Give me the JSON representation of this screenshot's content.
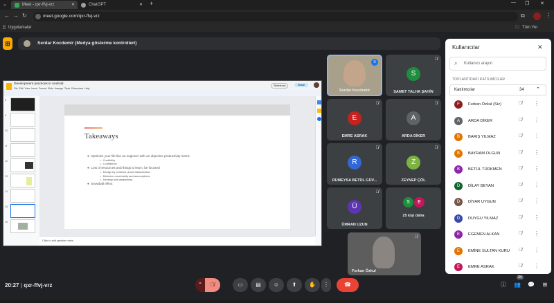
{
  "browser": {
    "tabs": [
      {
        "title": "Meet - qxr-ffvj-vrz",
        "active": true
      },
      {
        "title": "ChatGPT",
        "active": false
      }
    ],
    "new_tab": "+",
    "url": "meet.google.com/qxr-ffvj-vrz",
    "bookmarks_left": "Uygulamalar",
    "bookmarks_right": "Tüm Yer İşaretleri"
  },
  "meet": {
    "presenter_label": "Serdar Kocdemir (Medya gösterme kontrolleri)",
    "meeting_code": "qxr-ffvj-vrz",
    "time": "20:27",
    "slides": {
      "doc_title": "Development practices in Android",
      "menu": [
        "File",
        "Edit",
        "View",
        "Insert",
        "Format",
        "Slide",
        "Arrange",
        "Tools",
        "Extensions",
        "Help"
      ],
      "share": "Share",
      "slideshow": "Slideshow",
      "slide_title": "Takeaways",
      "bullets": [
        {
          "level": 1,
          "text": "Optimize your life like an engineer with an objective productivity metric"
        },
        {
          "level": 2,
          "text": "Credibility"
        },
        {
          "level": 2,
          "text": "Confidence"
        },
        {
          "level": 1,
          "text": "Lots of resources and things to learn, be focused"
        },
        {
          "level": 2,
          "text": "Design by contract, avoid hallucination"
        },
        {
          "level": 2,
          "text": "Minimize uncertainty and assumptions"
        },
        {
          "level": 2,
          "text": "Develop self-awareness"
        },
        {
          "level": 1,
          "text": "Snowball effect"
        }
      ],
      "speaker_notes": "Click to add speaker notes",
      "thumb_numbers": [
        "8",
        "9",
        "10",
        "11",
        "12",
        "13",
        "14",
        "15",
        "16"
      ]
    },
    "tiles": [
      {
        "name": "Serdar Kocdemir",
        "initial": "",
        "color": "#b0a58f"
      },
      {
        "name": "SAMET TALHA ŞAHİN",
        "initial": "S",
        "color": "#1e8e3e"
      },
      {
        "name": "EMRE ASRAK",
        "initial": "E",
        "color": "#c5221f"
      },
      {
        "name": "ARDA DİKER",
        "initial": "A",
        "color": "#5f6368"
      },
      {
        "name": "RUMEYSA BETÜL GÜV...",
        "initial": "R",
        "color": "#3367d6"
      },
      {
        "name": "ZEYNEP ÇÖL",
        "initial": "Z",
        "color": "#7cb342"
      },
      {
        "name": "ÜMRAN UZUN",
        "initial": "Ü",
        "color": "#5e35b1"
      },
      {
        "name": "25 kişi daha",
        "initial": "S",
        "initial2": "E",
        "color": "#1e8e3e",
        "color2": "#c2185b"
      },
      {
        "name": "Furkan Özkul",
        "initial": "",
        "color": "#6d6d6d"
      }
    ],
    "participant_badge": "34"
  },
  "panel": {
    "title": "Kullanıcılar",
    "search_placeholder": "Kullanıcı arayın",
    "section_label": "TOPLANTIDAKİ KATILIMCILAR",
    "group_label": "Katılımcılar",
    "group_count": "34",
    "people": [
      {
        "name": "Furkan Özkul (Siz)",
        "initial": "F",
        "color": "#8b1e1e"
      },
      {
        "name": "ARDA DİKER",
        "initial": "A",
        "color": "#5f6368"
      },
      {
        "name": "BARIŞ YILMAZ",
        "initial": "B",
        "color": "#e37400"
      },
      {
        "name": "BAYRAM OLGUN",
        "initial": "B",
        "color": "#e37400"
      },
      {
        "name": "BETÜL TÜRKMEN",
        "initial": "B",
        "color": "#8e24aa"
      },
      {
        "name": "DİLAY BEYAN",
        "initial": "D",
        "color": "#0d652d"
      },
      {
        "name": "DİYAR UYGUN",
        "initial": "D",
        "color": "#795548"
      },
      {
        "name": "DUYGU YILMAZ",
        "initial": "D",
        "color": "#3949ab"
      },
      {
        "name": "EGEMEN ALKAN",
        "initial": "E",
        "color": "#8e24aa"
      },
      {
        "name": "EMİNE SULTAN KURU",
        "initial": "E",
        "color": "#e37400"
      },
      {
        "name": "EMRE ASRAK",
        "initial": "E",
        "color": "#c2185b"
      }
    ]
  }
}
